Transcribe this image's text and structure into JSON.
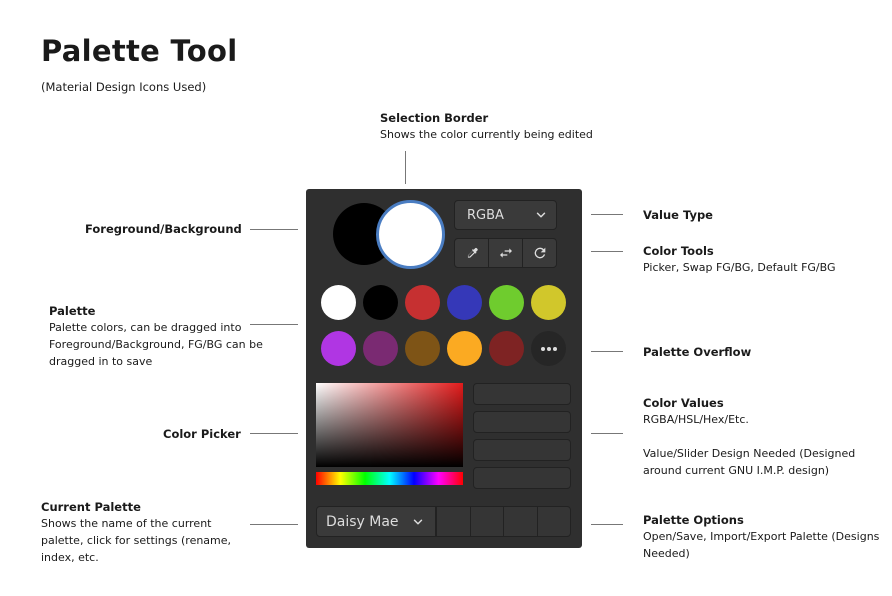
{
  "page": {
    "title": "Palette Tool",
    "subtitle": "(Material Design Icons Used)"
  },
  "annotations": {
    "selection_border": {
      "title": "Selection Border",
      "desc": "Shows the color currently being edited"
    },
    "foreground_background": {
      "title": "Foreground/Background"
    },
    "value_type": {
      "title": "Value Type"
    },
    "color_tools": {
      "title": "Color Tools",
      "desc": "Picker, Swap FG/BG, Default FG/BG"
    },
    "palette": {
      "title": "Palette",
      "desc": "Palette colors, can be dragged into Foreground/Background, FG/BG can be dragged in to save"
    },
    "palette_overflow": {
      "title": "Palette Overflow"
    },
    "color_picker": {
      "title": "Color Picker"
    },
    "color_values": {
      "title": "Color Values",
      "desc1": "RGBA/HSL/Hex/Etc.",
      "desc2": "Value/Slider Design Needed (Designed around current GNU I.M.P. design)"
    },
    "current_palette": {
      "title": "Current Palette",
      "desc": "Shows the name of the current palette, click for settings (rename, index, etc."
    },
    "palette_options": {
      "title": "Palette Options",
      "desc": "Open/Save, Import/Export Palette (Designs Needed)"
    }
  },
  "panel": {
    "foreground_color": "#000000",
    "background_color": "#ffffff",
    "selection_border_color": "#4a7dc2",
    "value_type": {
      "selected": "RGBA"
    },
    "tools": [
      {
        "name": "eyedropper-icon"
      },
      {
        "name": "swap-horizontal-icon"
      },
      {
        "name": "refresh-icon"
      }
    ],
    "palette_colors": [
      "#ffffff",
      "#000000",
      "#c63031",
      "#3538b8",
      "#6fcc2e",
      "#d1c72b",
      "#b036e3",
      "#7a2a72",
      "#7e5416",
      "#fbaa22",
      "#7e2323"
    ],
    "current_palette": {
      "name": "Daisy Mae"
    }
  }
}
